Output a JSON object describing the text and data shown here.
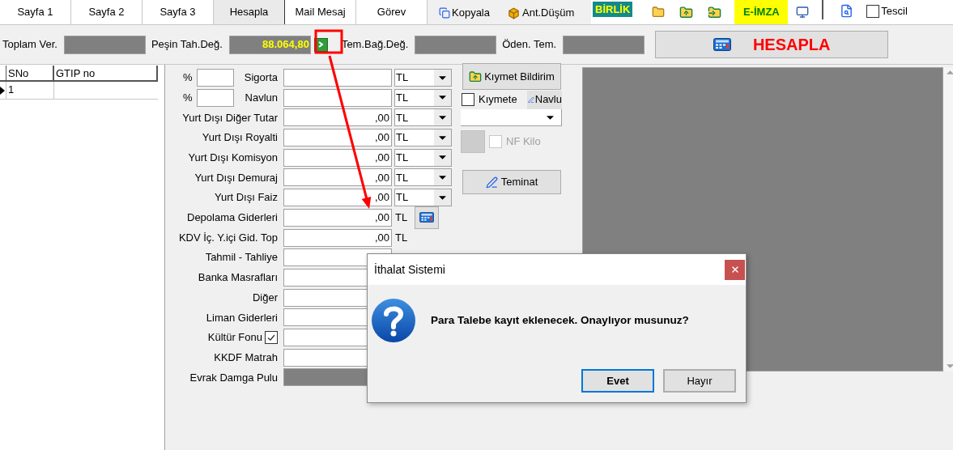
{
  "tabs": [
    {
      "label": "Sayfa 1",
      "selected": false
    },
    {
      "label": "Sayfa 2",
      "selected": false
    },
    {
      "label": "Sayfa 3",
      "selected": false
    },
    {
      "label": "Hesapla",
      "selected": true
    },
    {
      "label": "Mail Mesaj",
      "selected": false
    },
    {
      "label": "Görev",
      "selected": false
    }
  ],
  "toolbar": {
    "copy_button": "Kopyala",
    "deduction_button": "Ant.Düşüm",
    "union_badge": "BİRLİK",
    "e_signature_button": "E-İMZA",
    "register_checkbox": {
      "label": "Tescil",
      "checked": false
    }
  },
  "totals": [
    {
      "label": "Toplam Ver."
    },
    {
      "label": "Peşin Tah.Değ.",
      "value": "88.064,80",
      "has_action": true
    },
    {
      "label": "Tem.Bağ.Değ."
    },
    {
      "label": "Öden. Tem."
    }
  ],
  "calculate_button": "HESAPLA",
  "grid": {
    "columns": [
      "SNo",
      "GTIP no"
    ],
    "rows": [
      {
        "sno": "1",
        "current": true
      }
    ]
  },
  "form_rows": [
    {
      "kind": "percent",
      "percent_label": "%",
      "label": "Sigorta",
      "currency": "TL"
    },
    {
      "kind": "percent",
      "percent_label": "%",
      "label": "Navlun",
      "currency": "TL"
    },
    {
      "kind": "select",
      "label": "Yurt Dışı Diğer Tutar",
      "value": ",00",
      "currency": "TL"
    },
    {
      "kind": "select",
      "label": "Yurt Dışı Royalti",
      "value": ",00",
      "currency": "TL"
    },
    {
      "kind": "select",
      "label": "Yurt Dışı Komisyon",
      "value": ",00",
      "currency": "TL"
    },
    {
      "kind": "select",
      "label": "Yurt Dışı Demuraj",
      "value": ",00",
      "currency": "TL"
    },
    {
      "kind": "select",
      "label": "Yurt Dışı Faiz",
      "value": ",00",
      "currency": "TL"
    },
    {
      "kind": "calc",
      "label": "Depolama Giderleri",
      "value": ",00",
      "currency": "TL"
    },
    {
      "kind": "unit",
      "label": "KDV İç. Y.içi Gid. Top",
      "value": ",00",
      "currency": "TL"
    },
    {
      "kind": "plain",
      "label": "Tahmil - Tahliye"
    },
    {
      "kind": "plain",
      "label": "Banka Masrafları"
    },
    {
      "kind": "plain",
      "label": "Diğer"
    },
    {
      "kind": "plain",
      "label": "Liman Giderleri"
    },
    {
      "kind": "check",
      "label": "Kültür Fonu",
      "checked": true
    },
    {
      "kind": "plain",
      "label": "KKDF Matrah"
    },
    {
      "kind": "readonly",
      "label": "Evrak Damga Pulu"
    }
  ],
  "side": {
    "value_declaration_button": "Kıymet Bildirim",
    "value_checkbox": {
      "label": "Kıymete",
      "checked": false
    },
    "freight_button": "Navlu",
    "net_weight_checkbox": {
      "label": "NF Kilo",
      "checked": false,
      "disabled": true
    },
    "guarantee_button": "Teminat"
  },
  "dialog": {
    "title": "İthalat Sistemi",
    "message": "Para Talebe kayıt eklenecek. Onaylıyor musunuz?",
    "buttons": [
      {
        "label": "Evet",
        "default": true
      },
      {
        "label": "Hayır",
        "default": false
      }
    ]
  }
}
